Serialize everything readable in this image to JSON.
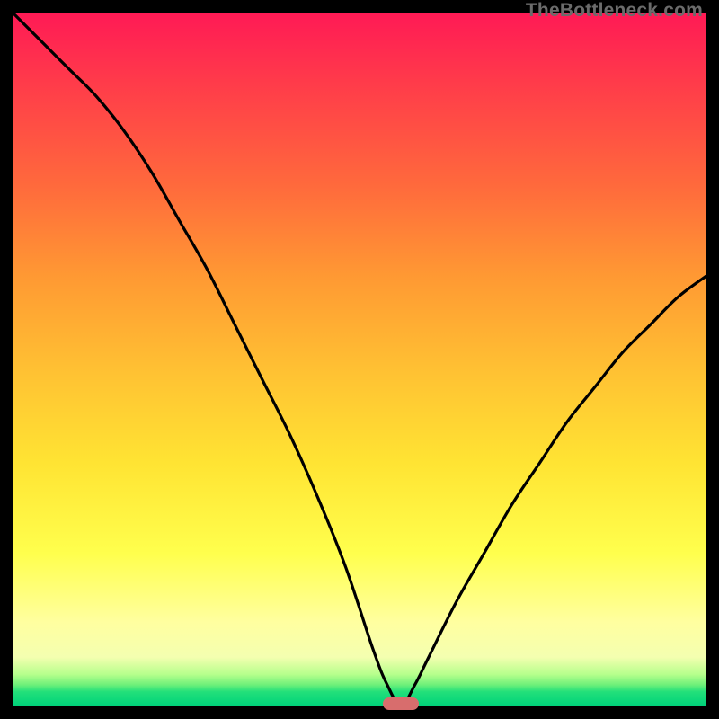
{
  "watermark": "TheBottleneck.com",
  "colors": {
    "frame": "#000000",
    "gradient_top": "#ff1a55",
    "gradient_bottom": "#00d27a",
    "curve": "#000000",
    "marker": "#d86d6d"
  },
  "chart_data": {
    "type": "line",
    "title": "",
    "xlabel": "",
    "ylabel": "",
    "xlim": [
      0,
      100
    ],
    "ylim": [
      0,
      100
    ],
    "grid": false,
    "legend": false,
    "notes": "Bottleneck-style curve: two asymmetric branches descending to a minimum near x≈56 at y≈0; left branch starts at top-left, right branch rises to ~y≈62 at x=100. A small rounded marker sits at the minimum. Background is a vertical red→green gradient inside a black frame.",
    "series": [
      {
        "name": "curve",
        "x": [
          0,
          4,
          8,
          12,
          16,
          20,
          24,
          28,
          32,
          36,
          40,
          44,
          48,
          52,
          54,
          56,
          58,
          60,
          64,
          68,
          72,
          76,
          80,
          84,
          88,
          92,
          96,
          100
        ],
        "y": [
          100,
          96,
          92,
          88,
          83,
          77,
          70,
          63,
          55,
          47,
          39,
          30,
          20,
          8,
          3,
          0,
          3,
          7,
          15,
          22,
          29,
          35,
          41,
          46,
          51,
          55,
          59,
          62
        ]
      }
    ],
    "marker": {
      "x": 56,
      "y": 0,
      "shape": "pill"
    }
  }
}
